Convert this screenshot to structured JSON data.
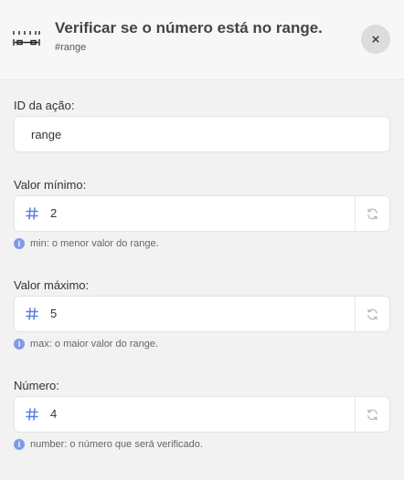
{
  "header": {
    "title": "Verificar se o número está no range.",
    "subtitle": "#range",
    "icon": "ruler-range-icon",
    "close_label": "×"
  },
  "action_id": {
    "label": "ID da ação:",
    "value": "range"
  },
  "min_value": {
    "label": "Valor mínimo:",
    "value": "2",
    "hint": "min: o menor valor do range."
  },
  "max_value": {
    "label": "Valor máximo:",
    "value": "5",
    "hint": "max: o maior valor do range."
  },
  "number": {
    "label": "Número:",
    "value": "4",
    "hint": "number: o número que será verificado."
  },
  "colors": {
    "accent": "#5b7fe0",
    "info": "#7d9be8"
  }
}
